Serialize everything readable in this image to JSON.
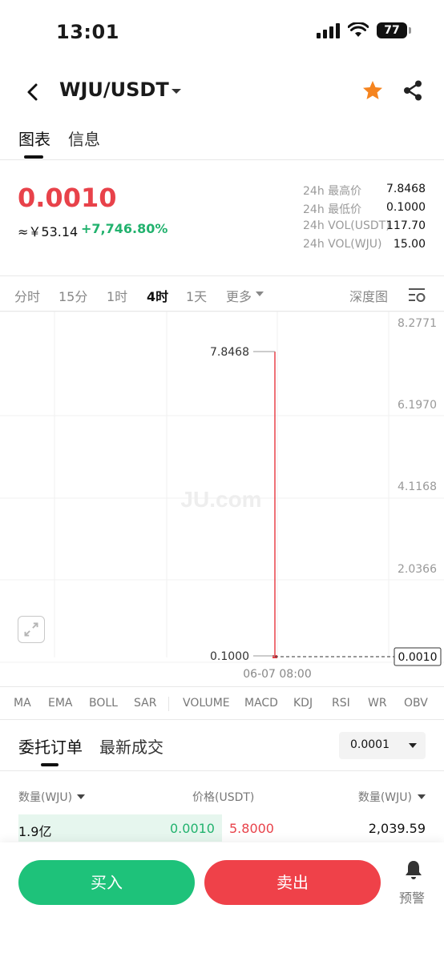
{
  "status_bar": {
    "time": "13:01",
    "battery": "77"
  },
  "header": {
    "pair": "WJU/USDT"
  },
  "top_tabs": [
    "图表",
    "信息"
  ],
  "ticker": {
    "last_price": "0.0010",
    "cny_price": "≈￥53.14",
    "change_pct": "+7,746.80%",
    "stats": [
      {
        "label": "24h 最高价",
        "value": "7.8468"
      },
      {
        "label": "24h 最低价",
        "value": "0.1000"
      },
      {
        "label": "24h VOL(USDT)",
        "value": "117.70"
      },
      {
        "label": "24h VOL(WJU)",
        "value": "15.00"
      }
    ]
  },
  "timeframes": {
    "items": [
      "分时",
      "15分",
      "1时",
      "4时",
      "1天",
      "更多"
    ],
    "active": "4时",
    "depth": "深度图"
  },
  "chart_data": {
    "type": "candlestick",
    "y_axis_ticks": [
      "8.2771",
      "6.1970",
      "4.1168",
      "2.0366"
    ],
    "ylim": [
      0.0,
      8.2771
    ],
    "x_label": "06-07 08:00",
    "candles": [
      {
        "time": "06-07 08:00",
        "open": 0.1,
        "high": 7.8468,
        "low": 0.1,
        "close": 0.001
      }
    ],
    "high_marker": "7.8468",
    "low_marker": "0.1000",
    "current_price_label": "0.0010",
    "watermark": "JU.com",
    "colors": {
      "down": "#e8424a",
      "up": "#22b26e"
    }
  },
  "indicators": [
    "MA",
    "EMA",
    "BOLL",
    "SAR",
    "VOLUME",
    "MACD",
    "KDJ",
    "RSI",
    "WR",
    "OBV"
  ],
  "order_book": {
    "tabs": [
      "委托订单",
      "最新成交"
    ],
    "precision": "0.0001",
    "headers": {
      "qty_left": "数量(WJU)",
      "price": "价格(USDT)",
      "qty_right": "数量(WJU)"
    },
    "rows": [
      {
        "bid_qty": "1.9亿",
        "bid_price": "0.0010",
        "ask_price": "5.8000",
        "ask_qty": "2,039.59"
      }
    ]
  },
  "actions": {
    "buy": "买入",
    "sell": "卖出",
    "alert": "预警"
  }
}
